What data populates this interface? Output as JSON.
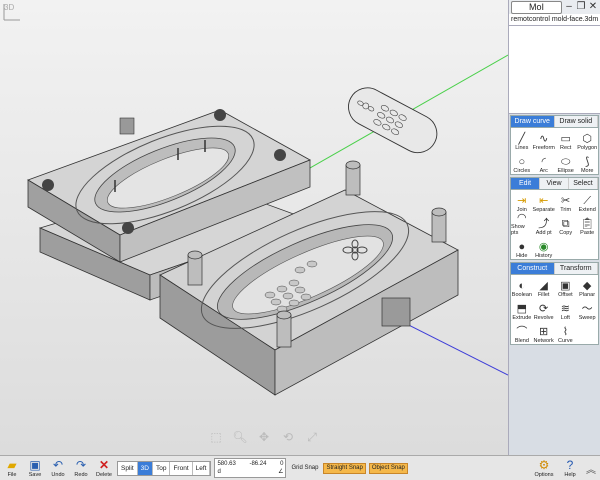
{
  "viewport": {
    "label": "3D"
  },
  "panel": {
    "app_title": "MoI",
    "filename": "remotcontrol mold-face.3dm",
    "draw_tabs": [
      "Draw curve",
      "Draw solid"
    ],
    "draw_tools": [
      {
        "label": "Lines",
        "icon": "line-icon"
      },
      {
        "label": "Freeform",
        "icon": "freeform-icon"
      },
      {
        "label": "Rect",
        "icon": "rect-icon"
      },
      {
        "label": "Polygon",
        "icon": "polygon-icon"
      },
      {
        "label": "Circles",
        "icon": "circle-icon"
      },
      {
        "label": "Arc",
        "icon": "arc-icon"
      },
      {
        "label": "Ellipse",
        "icon": "ellipse-icon"
      },
      {
        "label": "More",
        "icon": "more-icon"
      }
    ],
    "edit_tabs": [
      "Edit",
      "View",
      "Select"
    ],
    "edit_tools": [
      {
        "label": "Join",
        "icon": "join-icon"
      },
      {
        "label": "Separate",
        "icon": "separate-icon"
      },
      {
        "label": "Trim",
        "icon": "trim-icon"
      },
      {
        "label": "Extend",
        "icon": "extend-icon"
      },
      {
        "label": "Show pts",
        "icon": "show-points-icon"
      },
      {
        "label": "Add pt",
        "icon": "add-point-icon"
      },
      {
        "label": "Copy",
        "icon": "copy-icon"
      },
      {
        "label": "Paste",
        "icon": "paste-icon"
      },
      {
        "label": "Hide",
        "icon": "hide-icon"
      },
      {
        "label": "History",
        "icon": "history-icon"
      }
    ],
    "construct_tabs": [
      "Construct",
      "Transform"
    ],
    "construct_tools": [
      {
        "label": "Boolean",
        "icon": "boolean-icon"
      },
      {
        "label": "Fillet",
        "icon": "fillet-icon"
      },
      {
        "label": "Offset",
        "icon": "offset-icon"
      },
      {
        "label": "Planar",
        "icon": "planar-icon"
      },
      {
        "label": "Extrude",
        "icon": "extrude-icon"
      },
      {
        "label": "Revolve",
        "icon": "revolve-icon"
      },
      {
        "label": "Loft",
        "icon": "loft-icon"
      },
      {
        "label": "Sweep",
        "icon": "sweep-icon"
      },
      {
        "label": "Blend",
        "icon": "blend-icon"
      },
      {
        "label": "Network",
        "icon": "network-icon"
      },
      {
        "label": "Curve",
        "icon": "curve-icon"
      }
    ]
  },
  "bottom": {
    "file": "File",
    "save": "Save",
    "undo": "Undo",
    "redo": "Redo",
    "delete": "Delete",
    "views": [
      "Split",
      "3D",
      "Top",
      "Front",
      "Left"
    ],
    "coords": {
      "x": "580.63",
      "y": "-86.24",
      "z": "0"
    },
    "grid_snap": "Grid Snap",
    "straight_snap": "Straight Snap",
    "object_snap": "Object Snap",
    "options": "Options",
    "help": "Help"
  }
}
